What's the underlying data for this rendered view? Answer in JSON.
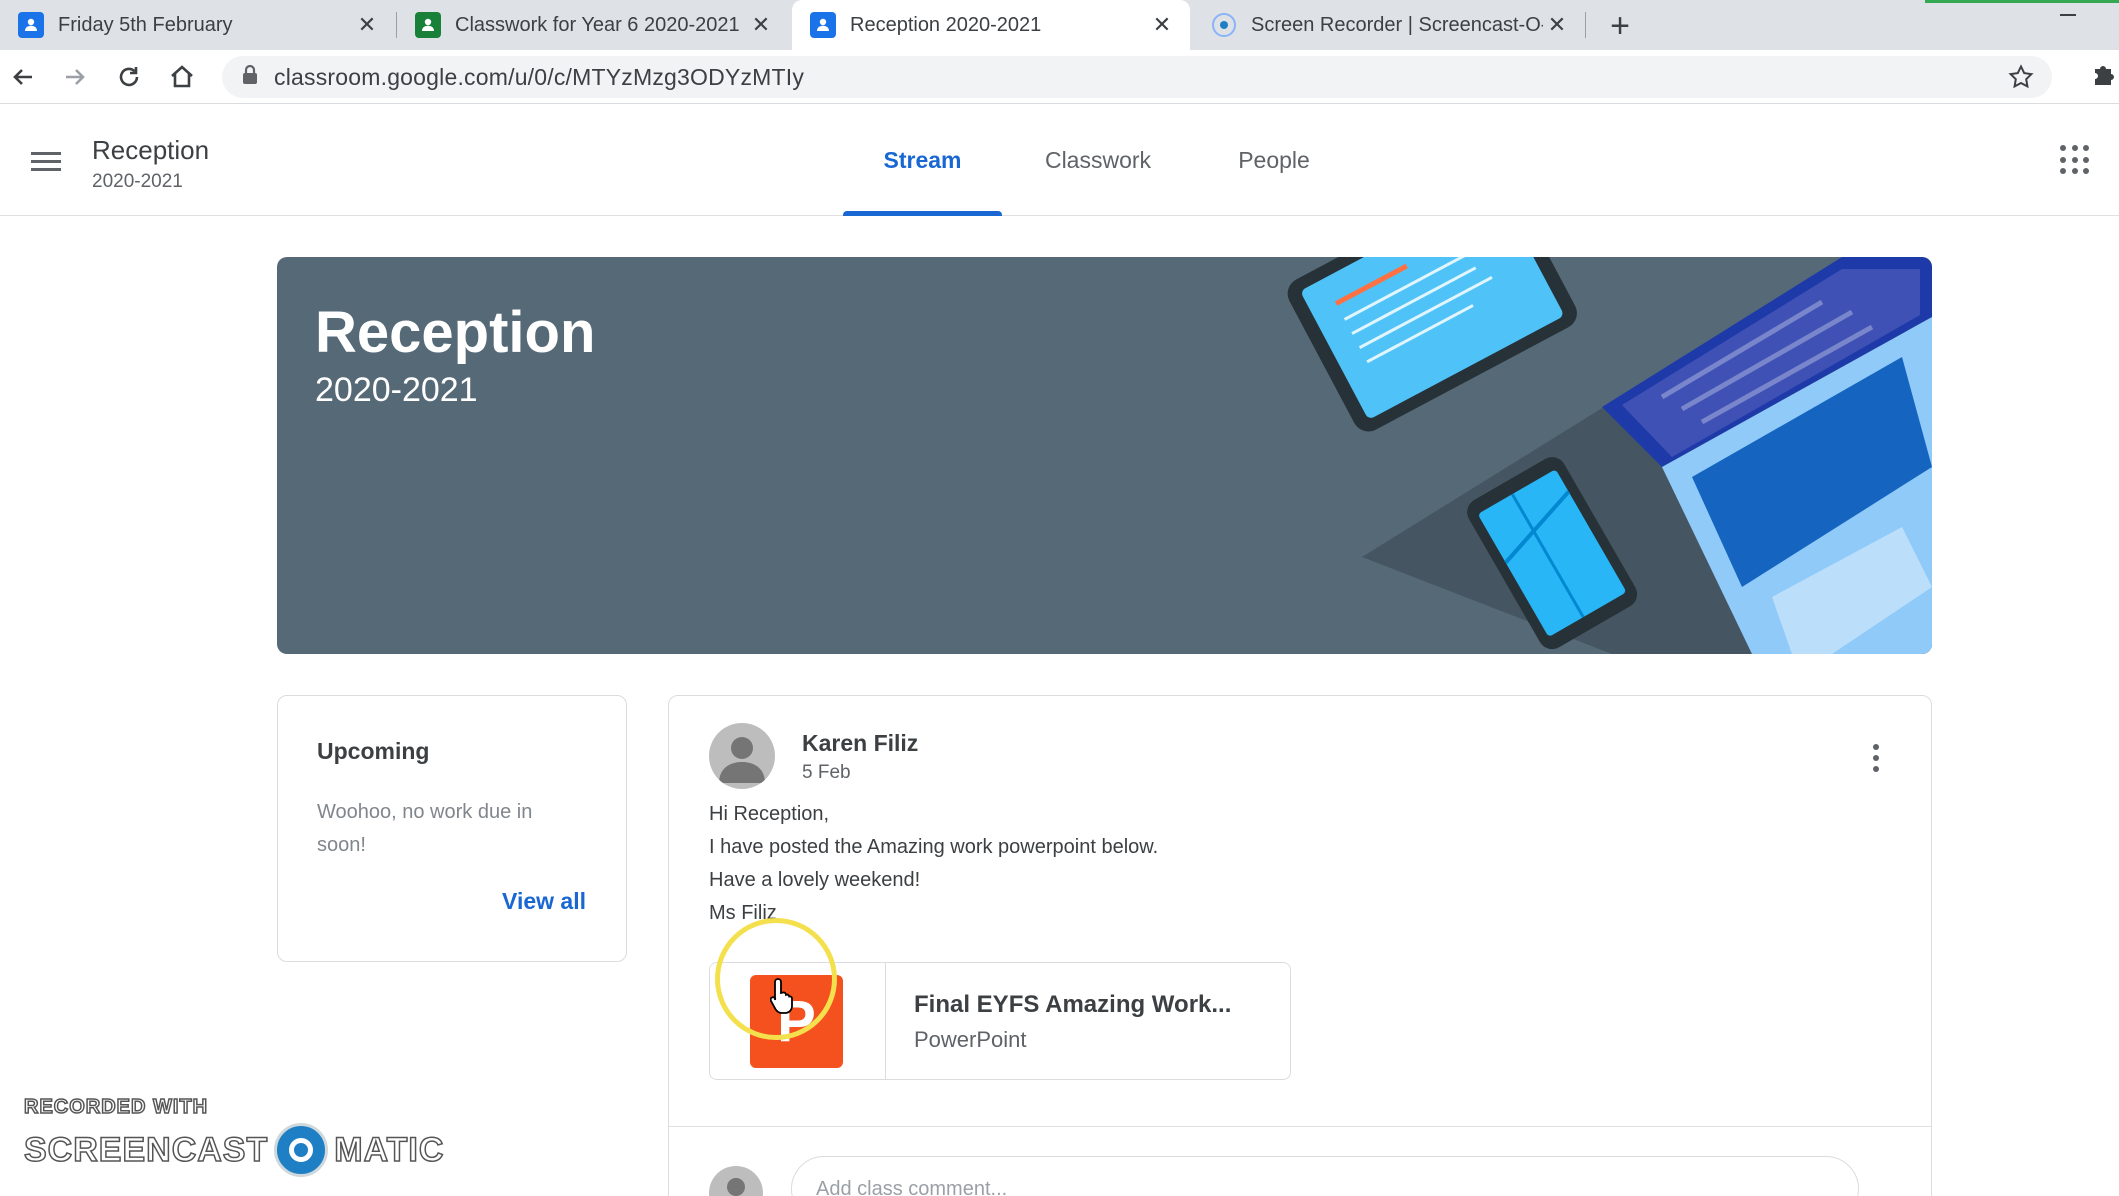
{
  "browser": {
    "tabs": [
      {
        "title": "Friday 5th February",
        "favicon": "classroom-favicon",
        "color": "#1a73e8"
      },
      {
        "title": "Classwork for Year 6 2020-2021",
        "favicon": "classroom-favicon",
        "color": "#188038"
      },
      {
        "title": "Reception 2020-2021",
        "favicon": "classroom-favicon",
        "color": "#1a73e8",
        "active": true
      },
      {
        "title": "Screen Recorder | Screencast-O-M",
        "favicon": "screencast-favicon",
        "color": "#1f7fc4"
      }
    ],
    "new_tab_label": "+",
    "url": "classroom.google.com/u/0/c/MTYzMzg3ODYzMTIy"
  },
  "class_header": {
    "title": "Reception",
    "subtitle": "2020-2021",
    "nav_tabs": [
      "Stream",
      "Classwork",
      "People"
    ],
    "active_tab": "Stream"
  },
  "banner": {
    "title": "Reception",
    "subtitle": "2020-2021",
    "background_color": "#566977"
  },
  "upcoming": {
    "title": "Upcoming",
    "message": "Woohoo, no work due in soon!",
    "link": "View all"
  },
  "post": {
    "author": "Karen Filiz",
    "date": "5 Feb",
    "lines": [
      "Hi Reception,",
      "I have posted the Amazing work powerpoint below.",
      "Have a lovely weekend!",
      "Ms Filiz"
    ],
    "attachment": {
      "title": "Final EYFS Amazing Work...",
      "type": "PowerPoint",
      "icon_letter": "P",
      "icon_color": "#f4511e"
    },
    "comment_placeholder": "Add class comment..."
  },
  "watermark": {
    "top": "RECORDED WITH",
    "left_word": "SCREENCAST",
    "right_word": "MATIC"
  },
  "colors": {
    "accent": "#1967d2",
    "text": "#3c4043",
    "muted": "#5f6368"
  }
}
